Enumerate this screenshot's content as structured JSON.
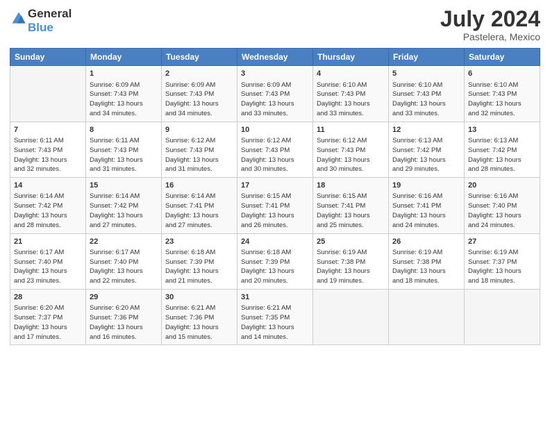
{
  "header": {
    "logo_general": "General",
    "logo_blue": "Blue",
    "title": "July 2024",
    "subtitle": "Pastelera, Mexico"
  },
  "calendar": {
    "days_of_week": [
      "Sunday",
      "Monday",
      "Tuesday",
      "Wednesday",
      "Thursday",
      "Friday",
      "Saturday"
    ],
    "weeks": [
      [
        {
          "day": "",
          "info": ""
        },
        {
          "day": "1",
          "info": "Sunrise: 6:09 AM\nSunset: 7:43 PM\nDaylight: 13 hours\nand 34 minutes."
        },
        {
          "day": "2",
          "info": "Sunrise: 6:09 AM\nSunset: 7:43 PM\nDaylight: 13 hours\nand 34 minutes."
        },
        {
          "day": "3",
          "info": "Sunrise: 6:09 AM\nSunset: 7:43 PM\nDaylight: 13 hours\nand 33 minutes."
        },
        {
          "day": "4",
          "info": "Sunrise: 6:10 AM\nSunset: 7:43 PM\nDaylight: 13 hours\nand 33 minutes."
        },
        {
          "day": "5",
          "info": "Sunrise: 6:10 AM\nSunset: 7:43 PM\nDaylight: 13 hours\nand 33 minutes."
        },
        {
          "day": "6",
          "info": "Sunrise: 6:10 AM\nSunset: 7:43 PM\nDaylight: 13 hours\nand 32 minutes."
        }
      ],
      [
        {
          "day": "7",
          "info": "Sunrise: 6:11 AM\nSunset: 7:43 PM\nDaylight: 13 hours\nand 32 minutes."
        },
        {
          "day": "8",
          "info": "Sunrise: 6:11 AM\nSunset: 7:43 PM\nDaylight: 13 hours\nand 31 minutes."
        },
        {
          "day": "9",
          "info": "Sunrise: 6:12 AM\nSunset: 7:43 PM\nDaylight: 13 hours\nand 31 minutes."
        },
        {
          "day": "10",
          "info": "Sunrise: 6:12 AM\nSunset: 7:43 PM\nDaylight: 13 hours\nand 30 minutes."
        },
        {
          "day": "11",
          "info": "Sunrise: 6:12 AM\nSunset: 7:43 PM\nDaylight: 13 hours\nand 30 minutes."
        },
        {
          "day": "12",
          "info": "Sunrise: 6:13 AM\nSunset: 7:42 PM\nDaylight: 13 hours\nand 29 minutes."
        },
        {
          "day": "13",
          "info": "Sunrise: 6:13 AM\nSunset: 7:42 PM\nDaylight: 13 hours\nand 28 minutes."
        }
      ],
      [
        {
          "day": "14",
          "info": "Sunrise: 6:14 AM\nSunset: 7:42 PM\nDaylight: 13 hours\nand 28 minutes."
        },
        {
          "day": "15",
          "info": "Sunrise: 6:14 AM\nSunset: 7:42 PM\nDaylight: 13 hours\nand 27 minutes."
        },
        {
          "day": "16",
          "info": "Sunrise: 6:14 AM\nSunset: 7:41 PM\nDaylight: 13 hours\nand 27 minutes."
        },
        {
          "day": "17",
          "info": "Sunrise: 6:15 AM\nSunset: 7:41 PM\nDaylight: 13 hours\nand 26 minutes."
        },
        {
          "day": "18",
          "info": "Sunrise: 6:15 AM\nSunset: 7:41 PM\nDaylight: 13 hours\nand 25 minutes."
        },
        {
          "day": "19",
          "info": "Sunrise: 6:16 AM\nSunset: 7:41 PM\nDaylight: 13 hours\nand 24 minutes."
        },
        {
          "day": "20",
          "info": "Sunrise: 6:16 AM\nSunset: 7:40 PM\nDaylight: 13 hours\nand 24 minutes."
        }
      ],
      [
        {
          "day": "21",
          "info": "Sunrise: 6:17 AM\nSunset: 7:40 PM\nDaylight: 13 hours\nand 23 minutes."
        },
        {
          "day": "22",
          "info": "Sunrise: 6:17 AM\nSunset: 7:40 PM\nDaylight: 13 hours\nand 22 minutes."
        },
        {
          "day": "23",
          "info": "Sunrise: 6:18 AM\nSunset: 7:39 PM\nDaylight: 13 hours\nand 21 minutes."
        },
        {
          "day": "24",
          "info": "Sunrise: 6:18 AM\nSunset: 7:39 PM\nDaylight: 13 hours\nand 20 minutes."
        },
        {
          "day": "25",
          "info": "Sunrise: 6:19 AM\nSunset: 7:38 PM\nDaylight: 13 hours\nand 19 minutes."
        },
        {
          "day": "26",
          "info": "Sunrise: 6:19 AM\nSunset: 7:38 PM\nDaylight: 13 hours\nand 18 minutes."
        },
        {
          "day": "27",
          "info": "Sunrise: 6:19 AM\nSunset: 7:37 PM\nDaylight: 13 hours\nand 18 minutes."
        }
      ],
      [
        {
          "day": "28",
          "info": "Sunrise: 6:20 AM\nSunset: 7:37 PM\nDaylight: 13 hours\nand 17 minutes."
        },
        {
          "day": "29",
          "info": "Sunrise: 6:20 AM\nSunset: 7:36 PM\nDaylight: 13 hours\nand 16 minutes."
        },
        {
          "day": "30",
          "info": "Sunrise: 6:21 AM\nSunset: 7:36 PM\nDaylight: 13 hours\nand 15 minutes."
        },
        {
          "day": "31",
          "info": "Sunrise: 6:21 AM\nSunset: 7:35 PM\nDaylight: 13 hours\nand 14 minutes."
        },
        {
          "day": "",
          "info": ""
        },
        {
          "day": "",
          "info": ""
        },
        {
          "day": "",
          "info": ""
        }
      ]
    ]
  }
}
